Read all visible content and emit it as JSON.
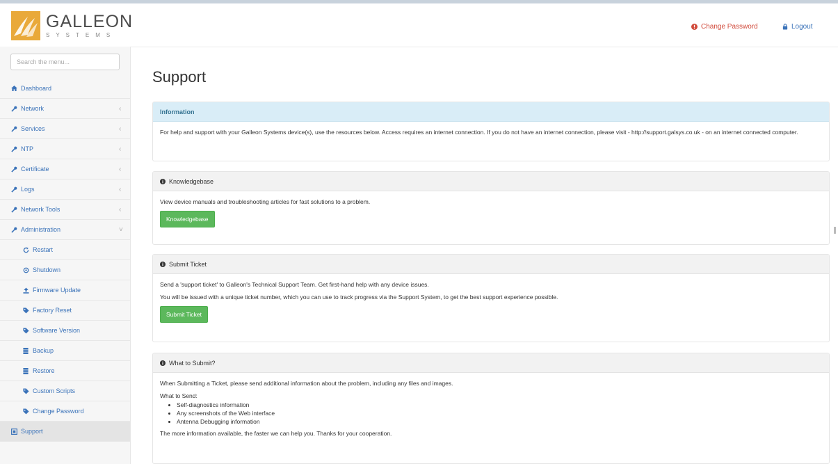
{
  "header": {
    "logo_name": "GALLEON",
    "logo_sub": "SYSTEMS",
    "change_password": "Change Password",
    "logout": "Logout"
  },
  "sidebar": {
    "search_placeholder": "Search the menu...",
    "items": [
      {
        "label": "Dashboard",
        "icon": "home-icon"
      },
      {
        "label": "Network",
        "icon": "wrench-icon",
        "arrow": "‹"
      },
      {
        "label": "Services",
        "icon": "wrench-icon",
        "arrow": "‹"
      },
      {
        "label": "NTP",
        "icon": "wrench-icon",
        "arrow": "‹"
      },
      {
        "label": "Certificate",
        "icon": "wrench-icon",
        "arrow": "‹"
      },
      {
        "label": "Logs",
        "icon": "wrench-icon",
        "arrow": "‹"
      },
      {
        "label": "Network Tools",
        "icon": "wrench-icon",
        "arrow": "‹"
      },
      {
        "label": "Administration",
        "icon": "wrench-icon",
        "arrow": "˅"
      },
      {
        "label": "Restart",
        "icon": "refresh-icon"
      },
      {
        "label": "Shutdown",
        "icon": "power-icon"
      },
      {
        "label": "Firmware Update",
        "icon": "upload-icon"
      },
      {
        "label": "Factory Reset",
        "icon": "tag-icon"
      },
      {
        "label": "Software Version",
        "icon": "tag-icon"
      },
      {
        "label": "Backup",
        "icon": "database-icon"
      },
      {
        "label": "Restore",
        "icon": "database-icon"
      },
      {
        "label": "Custom Scripts",
        "icon": "tag-icon"
      },
      {
        "label": "Change Password",
        "icon": "tag-icon"
      },
      {
        "label": "Support",
        "icon": "support-icon"
      }
    ]
  },
  "main": {
    "title": "Support",
    "information": {
      "heading": "Information",
      "text": "For help and support with your Galleon Systems device(s), use the resources below. Access requires an internet connection. If you do not have an internet connection, please visit - http://support.galsys.co.uk - on an internet connected computer."
    },
    "knowledgebase": {
      "heading": "Knowledgebase",
      "text": "View device manuals and troubleshooting articles for fast solutions to a problem.",
      "button": "Knowledgebase"
    },
    "submit_ticket": {
      "heading": "Submit Ticket",
      "text1": "Send a 'support ticket' to Galleon's Technical Support Team. Get first-hand help with any device issues.",
      "text2": "You will be issued with a unique ticket number, which you can use to track progress via the Support System, to get the best support experience possible.",
      "button": "Submit Ticket"
    },
    "what_to_submit": {
      "heading": "What to Submit?",
      "text1": "When Submitting a Ticket, please send additional information about the problem, including any files and images.",
      "text2": "What to Send:",
      "bullets": [
        "Self-diagnostics information",
        "Any screenshots of the Web interface",
        "Antenna Debugging information"
      ],
      "text3": "The more information available, the faster we can help you. Thanks for your cooperation."
    }
  },
  "colors": {
    "accent": "#3b73b9",
    "button_green": "#5cb85c",
    "info_bg": "#d9edf7",
    "alert_red": "#d14a3b"
  }
}
